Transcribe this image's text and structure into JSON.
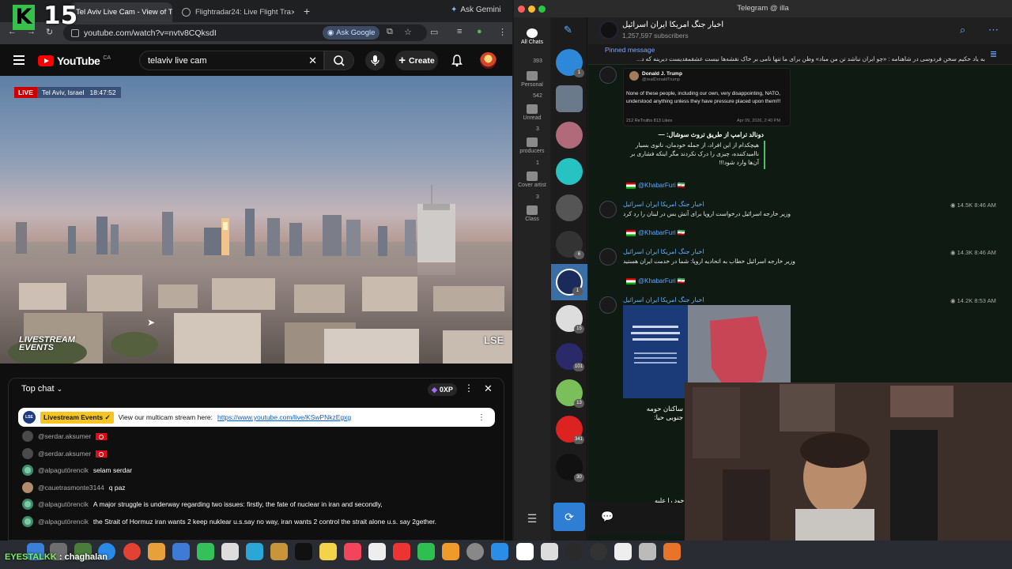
{
  "overlay": {
    "badge_letter": "K",
    "badge_number": "15",
    "streamer_label": "EYESTALKK",
    "streamer_name": "chaghalan"
  },
  "chrome": {
    "tabs": [
      {
        "title": "Tel Aviv Live Cam - View of Te",
        "active": true
      },
      {
        "title": "Flightradar24: Live Flight Tra",
        "active": false
      }
    ],
    "ask_gemini": "Ask Gemini",
    "url": "youtube.com/watch?v=nvtv8CQksdI",
    "ask_google": "Ask Google"
  },
  "youtube": {
    "logo": "YouTube",
    "country": "CA",
    "search_value": "telaviv live cam",
    "create_label": "Create",
    "live_label": "LIVE",
    "location": "Tel Aviv, Israel",
    "time": "18:47:52",
    "watermark_left": "LIVESTREAM EVENTS",
    "watermark_right": "LSE"
  },
  "chat": {
    "mode": "Top chat",
    "xp": "0XP",
    "pinned": {
      "author": "Livestream Events",
      "text": "View our multicam stream here:",
      "link": "https://www.youtube.com/live/KSwPNkzEgxg"
    },
    "messages": [
      {
        "user": "@serdar.aksumer",
        "text": "",
        "flag": "tr",
        "avatar": "grey"
      },
      {
        "user": "@serdar.aksumer",
        "text": "",
        "flag": "tr",
        "avatar": "grey"
      },
      {
        "user": "@alpagutörencik",
        "text": "selam serdar",
        "avatar": "green"
      },
      {
        "user": "@cauetrasmonte3144",
        "text": "q paz",
        "avatar": "face"
      },
      {
        "user": "@alpagutörencik",
        "text": "A major struggle is underway regarding two issues: firstly, the fate of nuclear in iran and secondly,",
        "avatar": "green"
      },
      {
        "user": "@alpagutörencik",
        "text": "the Strait of Hormuz iran wants 2 keep nuklear u.s.say no way, iran wants 2 control the strait alone u.s. say 2gether.",
        "avatar": "green"
      }
    ]
  },
  "telegram": {
    "window_title": "Telegram @ illa",
    "folders": [
      {
        "label": "All Chats",
        "badge": ""
      },
      {
        "label": "Personal",
        "badge": "393"
      },
      {
        "label": "Unread",
        "badge": "542"
      },
      {
        "label": "producers",
        "badge": "3"
      },
      {
        "label": "Cover artist",
        "badge": "1"
      },
      {
        "label": "Class",
        "badge": "3"
      }
    ],
    "chat_counts": [
      "1",
      "",
      "",
      "",
      "",
      "6",
      "1",
      "15",
      "101",
      "13",
      "341",
      "30"
    ],
    "channel_title": "اخبار جنگ امریکا ایران اسرائیل",
    "subscribers": "1,257,597 subscribers",
    "pinned_label": "Pinned message",
    "pinned_text": "به یاد حکیم سخن فردوسی در شاهنامه : «چو ایران نباشد تن من مباد» وطن برای ما تنها نامی بر خاک نقشه‌ها نیست عشقمقدیست دیرینه که د...",
    "tweet": {
      "name": "Donald J. Trump",
      "handle": "@realDonaldTrump",
      "text": "None of these people, including our own, very disappointing, NATO, understood anything unless they have pressure placed upon them!!!",
      "stats": "212 ReTruths   813 Likes",
      "date": "Apr 09, 2026, 2:40 PM"
    },
    "trump_line": "دونالد ترامپ از طریق تروث سوشال: —",
    "quote": "هیچکدام از این افراد، از جمله خودمان، ناتوی بسیار ناامیدکننده، چیزی را درک نکردند مگر اینکه فشاری بر آن‌ها وارد شود!!!",
    "forward_handle": "@KhabarFuri",
    "posts": [
      {
        "author": "اخبار جنگ امریکا ایران اسرائیل",
        "text": "وزیر خارجه اسرائیل درخواست اروپا برای آتش بس در لبنان را رد کرد",
        "views": "14.5K",
        "time": "8:46 AM"
      },
      {
        "author": "اخبار جنگ امریکا ایران اسرائیل",
        "text": "وزیر خارجه اسرائیل خطاب به اتحادیه اروپا: شما در خدمت ایران هستید",
        "views": "14.3K",
        "time": "8:46 AM"
      },
      {
        "author": "اخبار جنگ امریکا ایران اسرائیل",
        "text": "",
        "views": "14.2K",
        "time": "8:53 AM"
      }
    ],
    "post_caption": "ساکنان حومه جنوبی حیا:",
    "bottom_text": "خود را علیه"
  },
  "colors": {
    "youtube_red": "#ff0000",
    "telegram_blue": "#3d8de8",
    "telegram_link": "#62b0ff",
    "live_red": "#cc0000",
    "accent_green": "#36c24a"
  }
}
